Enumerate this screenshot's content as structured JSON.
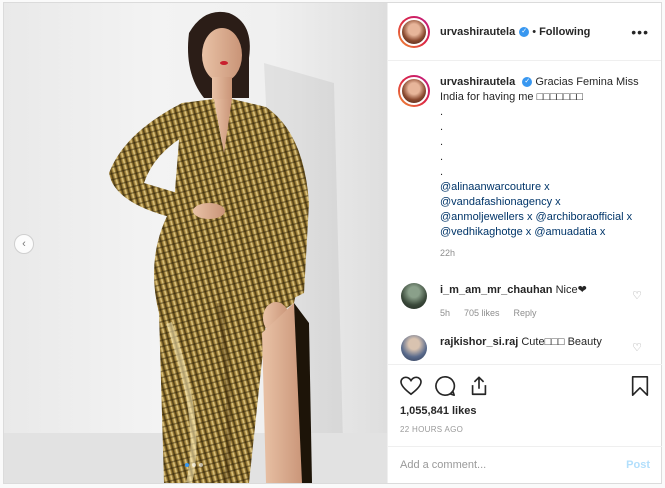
{
  "post": {
    "author": "urvashirautela",
    "following": "Following",
    "separator": "•",
    "more": "•••"
  },
  "caption": {
    "author": "urvashirautela",
    "text": "Gracias Femina Miss India for having me □□□□□□□",
    "dots": [
      ".",
      ".",
      ".",
      ".",
      "."
    ],
    "mentions": "@alinaanwarcouture x @vandafashionagency x @anmoljewellers x @archiboraofficial x @vedhikaghotge x @amuadatia x",
    "time": "22h"
  },
  "comments": [
    {
      "user": "i_m_am_mr_chauhan",
      "text": "Nice❤",
      "time": "5h",
      "likes": "705 likes",
      "reply": "Reply"
    },
    {
      "user": "rajkishor_si.raj",
      "text": "Cute□□□ Beauty",
      "time": "",
      "likes": "",
      "reply": ""
    }
  ],
  "likes": "1,055,841 likes",
  "timestamp": "22 HOURS AGO",
  "add_comment": {
    "placeholder": "Add a comment...",
    "post_label": "Post"
  },
  "icons": {
    "like": "heart-icon",
    "comment": "comment-bubble-icon",
    "share": "share-icon",
    "save": "bookmark-icon",
    "prev": "chevron-left-icon"
  },
  "carousel": {
    "count": 3,
    "active": 0
  },
  "colors": {
    "accent": "#3897f0",
    "mention": "#003569",
    "muted": "#8e8e8e",
    "post_disabled": "#b2dffc"
  }
}
